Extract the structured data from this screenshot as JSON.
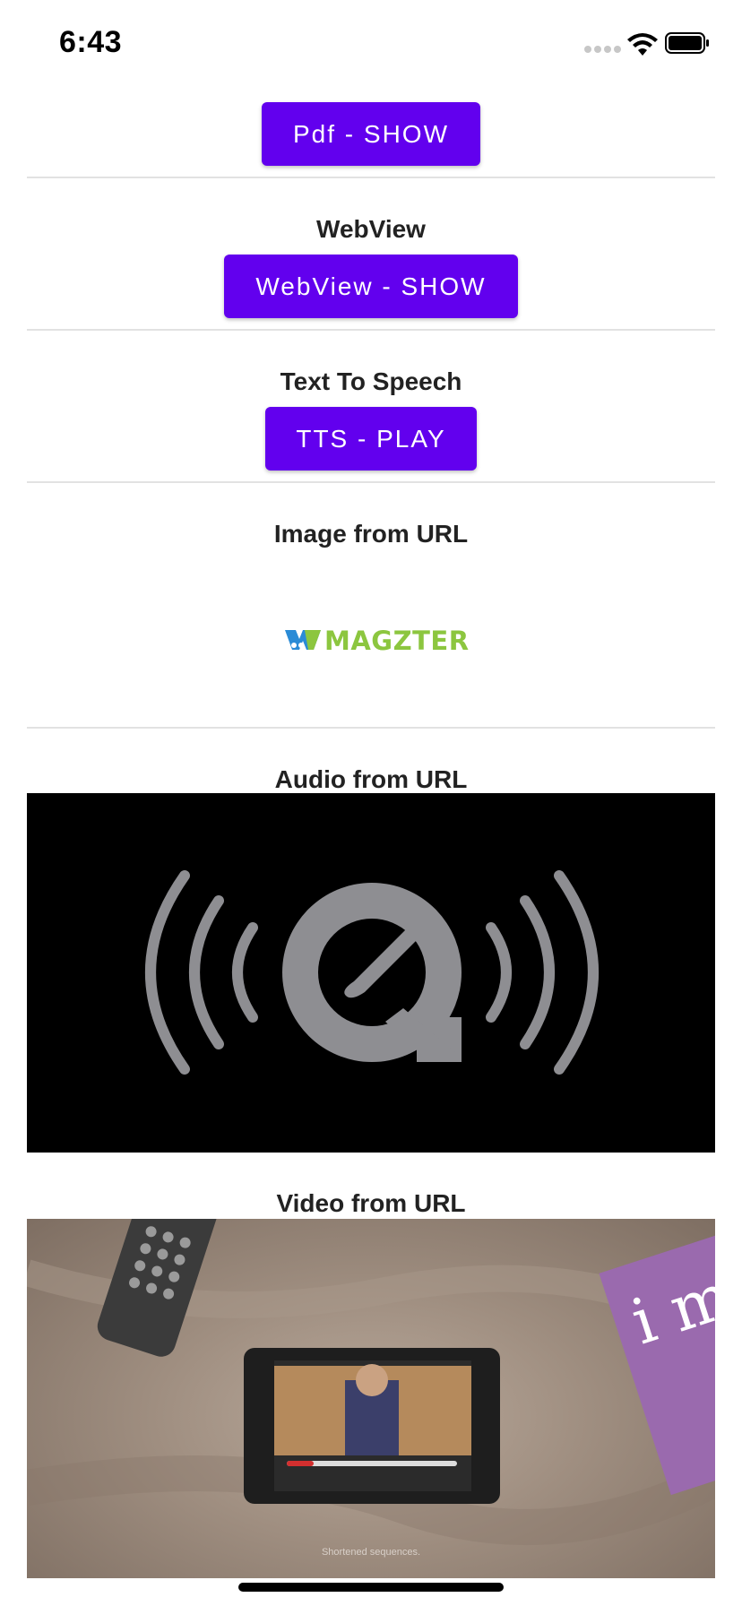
{
  "status_bar": {
    "time": "6:43"
  },
  "sections": {
    "pdf": {
      "button_label": "Pdf - SHOW"
    },
    "webview": {
      "title": "WebView",
      "button_label": "WebView - SHOW"
    },
    "tts": {
      "title": "Text To Speech",
      "button_label": "TTS - PLAY"
    },
    "image": {
      "title": "Image from URL",
      "logo_text": "MAGZTER"
    },
    "audio": {
      "title": "Audio from URL",
      "player_icon": "quicktime-audio-icon"
    },
    "video": {
      "title": "Video from URL",
      "caption": "Shortened sequences."
    }
  },
  "colors": {
    "primary_button": "#6200ee",
    "logo_green": "#8cc63f",
    "logo_blue": "#2a8bd6"
  }
}
